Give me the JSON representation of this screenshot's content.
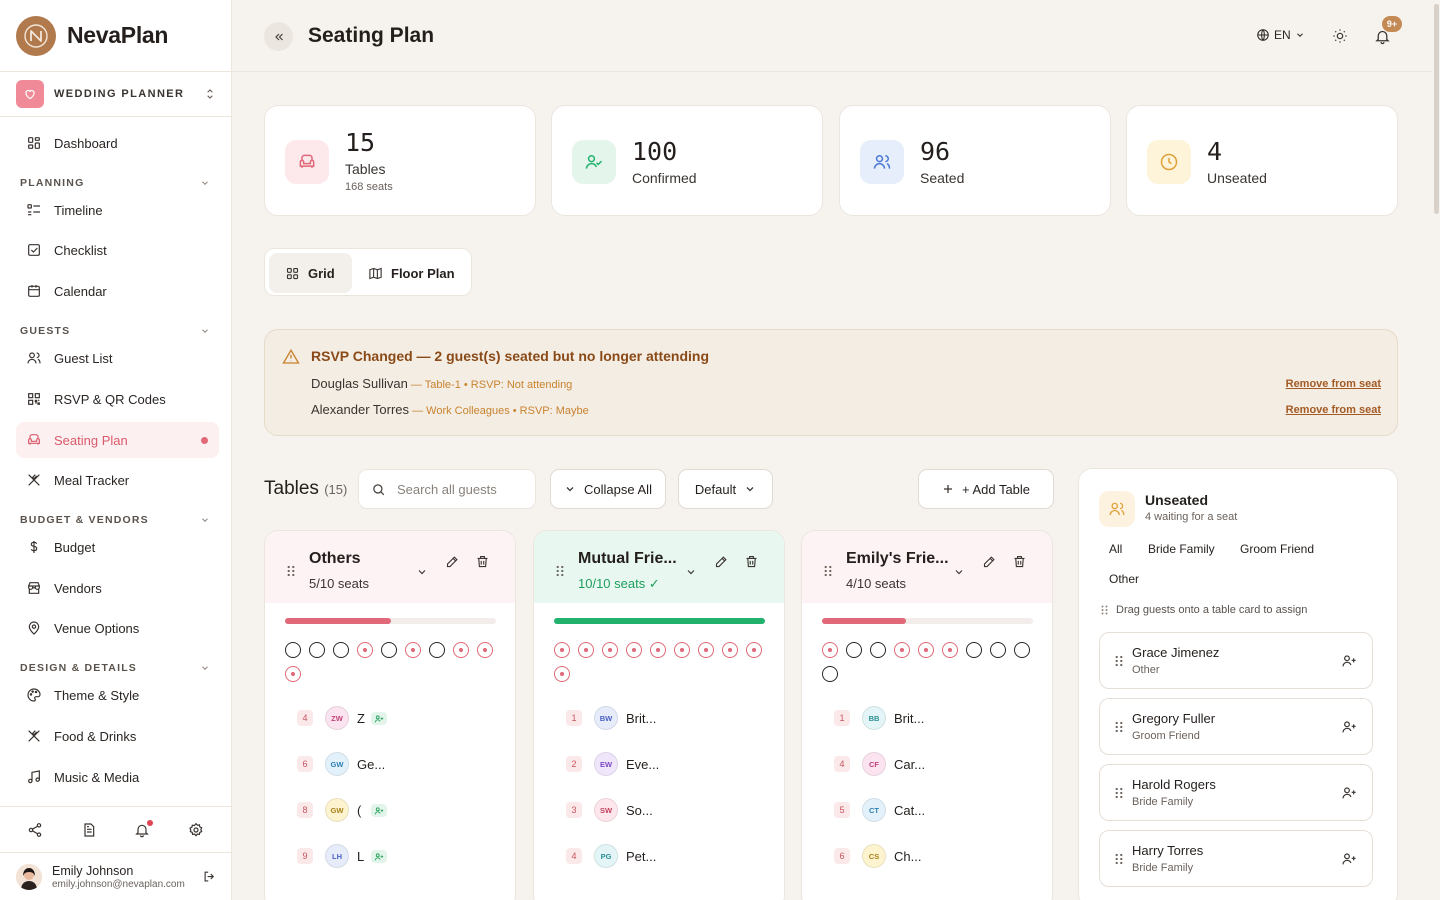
{
  "app": {
    "name": "NevaPlan",
    "workspace": "WEDDING PLANNER",
    "page_title": "Seating Plan",
    "language": "EN",
    "notification_badge": "9+"
  },
  "sidebar": {
    "dashboard": "Dashboard",
    "sections": {
      "planning": "PLANNING",
      "guests": "GUESTS",
      "budget": "BUDGET & VENDORS",
      "design": "DESIGN & DETAILS"
    },
    "items": {
      "timeline": "Timeline",
      "checklist": "Checklist",
      "calendar": "Calendar",
      "guest_list": "Guest List",
      "rsvp": "RSVP & QR Codes",
      "seating": "Seating Plan",
      "meal": "Meal Tracker",
      "budget": "Budget",
      "vendors": "Vendors",
      "venue": "Venue Options",
      "theme": "Theme & Style",
      "food": "Food & Drinks",
      "music": "Music & Media"
    },
    "user": {
      "name": "Emily Johnson",
      "email": "emily.johnson@nevaplan.com"
    }
  },
  "stats": {
    "tables": {
      "value": "15",
      "label": "Tables",
      "sub": "168 seats"
    },
    "confirmed": {
      "value": "100",
      "label": "Confirmed"
    },
    "seated": {
      "value": "96",
      "label": "Seated"
    },
    "unseated": {
      "value": "4",
      "label": "Unseated"
    }
  },
  "view_toggle": {
    "grid": "Grid",
    "floor": "Floor Plan"
  },
  "alert": {
    "title": "RSVP Changed — 2 guest(s) seated but no longer attending",
    "rows": [
      {
        "name": "Douglas Sullivan",
        "meta": " — Table-1 • RSVP: Not attending",
        "action": "Remove from seat"
      },
      {
        "name": "Alexander Torres",
        "meta": " — Work Colleagues • RSVP: Maybe",
        "action": "Remove from seat"
      }
    ]
  },
  "toolbar": {
    "title": "Tables",
    "count": "(15)",
    "search_placeholder": "Search all guests",
    "collapse_all": "Collapse All",
    "sort": "Default",
    "add_table": "+ Add Table"
  },
  "tables": [
    {
      "name": "Others",
      "seats_text": "5/10 seats",
      "fill_fraction": 0.5,
      "bar_color": "#e06878",
      "seat_states": [
        "filled",
        "filled",
        "filled",
        "pending",
        "filled",
        "pending",
        "filled",
        "pending",
        "pending",
        "pending"
      ],
      "guests": [
        {
          "seat": "4",
          "initials": "ZW",
          "name": "Z",
          "badge": true
        },
        {
          "seat": "6",
          "initials": "GW",
          "name": "Ge...",
          "badge": false
        },
        {
          "seat": "8",
          "initials": "GW",
          "name": "(",
          "badge": true
        },
        {
          "seat": "9",
          "initials": "LH",
          "name": "L",
          "badge": true
        }
      ]
    },
    {
      "name": "Mutual Frie...",
      "seats_text": "10/10 seats ✓",
      "fill_fraction": 1.0,
      "bar_color": "#23b26d",
      "seat_states": [
        "pending",
        "pending",
        "pending",
        "pending",
        "pending",
        "pending",
        "pending",
        "pending",
        "pending",
        "pending"
      ],
      "guests": [
        {
          "seat": "1",
          "initials": "BW",
          "name": "Brit...",
          "badge": false
        },
        {
          "seat": "2",
          "initials": "EW",
          "name": "Eve...",
          "badge": false
        },
        {
          "seat": "3",
          "initials": "SW",
          "name": "So...",
          "badge": false
        },
        {
          "seat": "4",
          "initials": "PG",
          "name": "Pet...",
          "badge": false
        }
      ]
    },
    {
      "name": "Emily's Frie...",
      "seats_text": "4/10 seats",
      "fill_fraction": 0.4,
      "bar_color": "#e06878",
      "seat_states": [
        "pending",
        "filled",
        "filled",
        "pending",
        "pending",
        "pending",
        "filled",
        "filled",
        "filled",
        "filled"
      ],
      "guests": [
        {
          "seat": "1",
          "initials": "BB",
          "name": "Brit...",
          "badge": false
        },
        {
          "seat": "4",
          "initials": "CF",
          "name": "Car...",
          "badge": false
        },
        {
          "seat": "5",
          "initials": "CT",
          "name": "Cat...",
          "badge": false
        },
        {
          "seat": "6",
          "initials": "CS",
          "name": "Ch...",
          "badge": false
        }
      ]
    }
  ],
  "unseated_panel": {
    "title": "Unseated",
    "subtitle": "4 waiting for a seat",
    "filters": [
      "All",
      "Bride Family",
      "Groom Friend",
      "Other"
    ],
    "hint": "Drag guests onto a table card to assign",
    "guests": [
      {
        "name": "Grace Jimenez",
        "group": "Other"
      },
      {
        "name": "Gregory Fuller",
        "group": "Groom Friend"
      },
      {
        "name": "Harold Rogers",
        "group": "Bride Family"
      },
      {
        "name": "Harry Torres",
        "group": "Bride Family"
      }
    ]
  },
  "colors": {
    "accent_pink": "#e06878",
    "success_green": "#23b26d",
    "warning_amber": "#c8832f",
    "brand_bronze": "#b07a4d"
  }
}
